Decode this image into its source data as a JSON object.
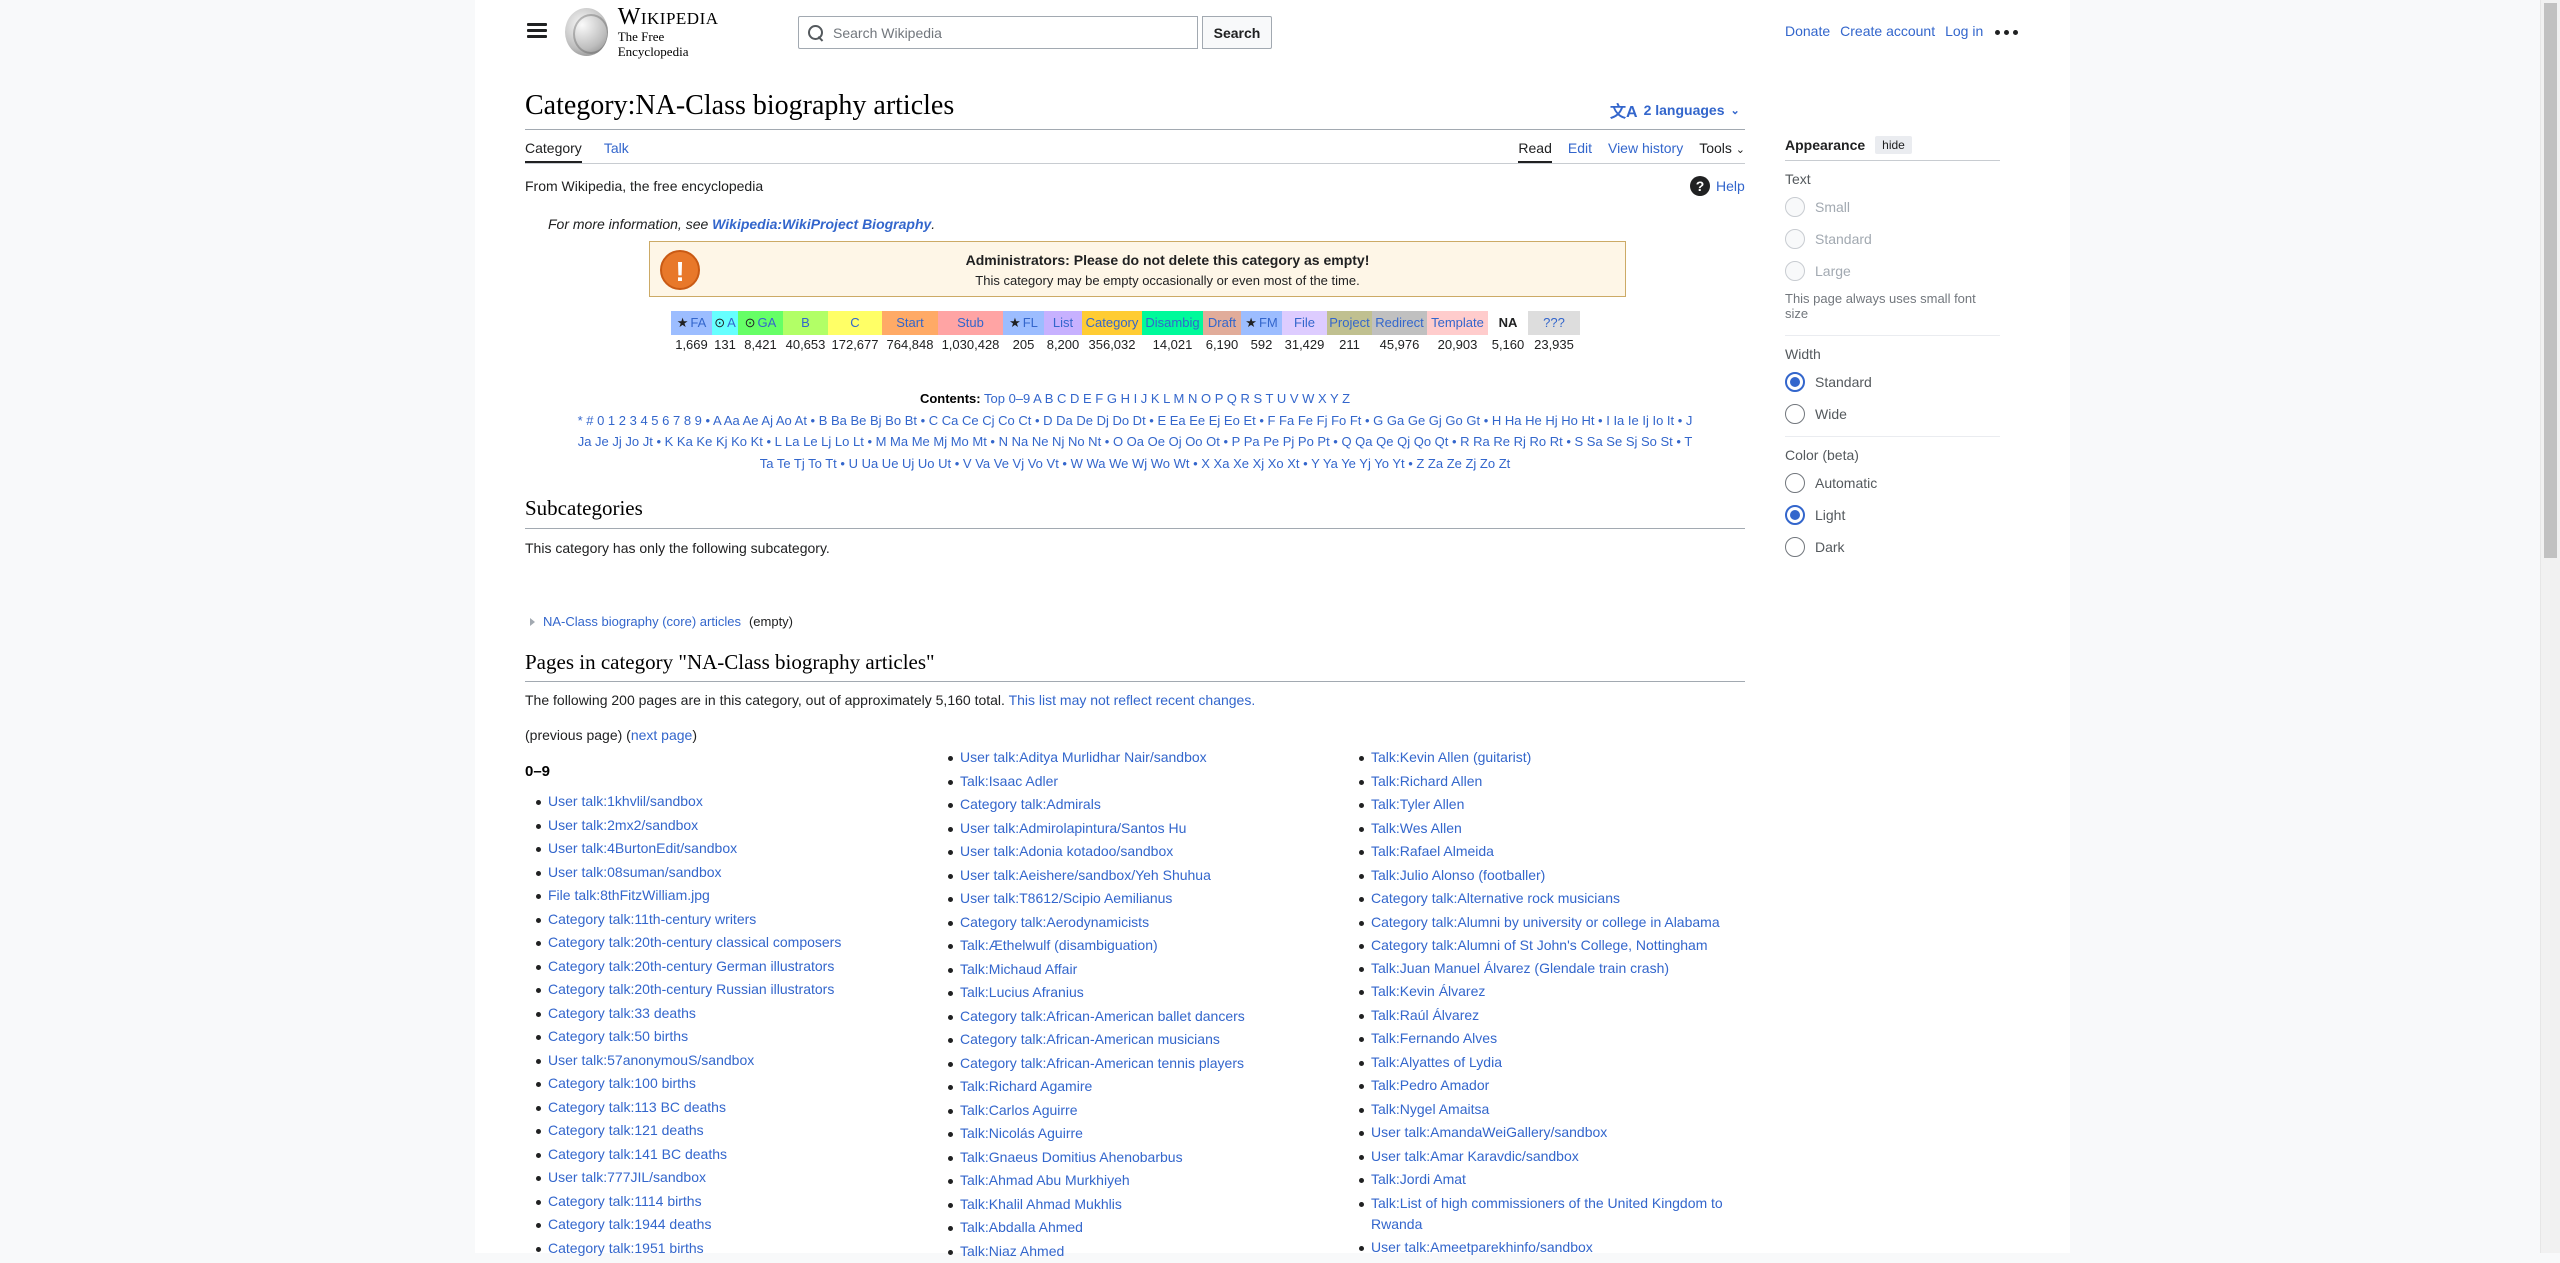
{
  "header": {
    "wordmark_title": "Wikipedia",
    "wordmark_tagline": "The Free Encyclopedia",
    "search_placeholder": "Search Wikipedia",
    "search_button": "Search",
    "user_links": [
      "Donate",
      "Create account",
      "Log in"
    ]
  },
  "page": {
    "title": "Category:NA-Class biography articles",
    "languages": "2 languages",
    "tabs_left": [
      "Category",
      "Talk"
    ],
    "tabs_right": [
      "Read",
      "Edit",
      "View history",
      "Tools"
    ],
    "tagline": "From Wikipedia, the free encyclopedia",
    "help": "Help",
    "moreinfo_prefix": "For more information, see ",
    "moreinfo_link": "Wikipedia:WikiProject Biography",
    "moreinfo_suffix": "."
  },
  "admin_box": {
    "heading": "Administrators: Please do not delete this category as empty!",
    "text": "This category may be empty occasionally or even most of the time."
  },
  "class_table": [
    {
      "label": "FA",
      "count": "1,669",
      "color": "#9cbdff",
      "star": true,
      "w": 41
    },
    {
      "label": "A",
      "count": "131",
      "color": "#66ffff",
      "circ": true,
      "w": 26
    },
    {
      "label": "GA",
      "count": "8,421",
      "color": "#66ff66",
      "circ": true,
      "w": 45
    },
    {
      "label": "B",
      "count": "40,653",
      "color": "#b2ff66",
      "w": 45
    },
    {
      "label": "C",
      "count": "172,677",
      "color": "#ffff66",
      "w": 54
    },
    {
      "label": "Start",
      "count": "764,848",
      "color": "#ffaa66",
      "w": 56
    },
    {
      "label": "Stub",
      "count": "1,030,428",
      "color": "#ffa4a4",
      "w": 65
    },
    {
      "label": "FL",
      "count": "205",
      "color": "#9cbdff",
      "star": true,
      "w": 41
    },
    {
      "label": "List",
      "count": "8,200",
      "color": "#c7b1ff",
      "w": 38
    },
    {
      "label": "Category",
      "count": "356,032",
      "color": "#ffcc33",
      "w": 60
    },
    {
      "label": "Disambig",
      "count": "14,021",
      "color": "#00fa9a",
      "w": 61
    },
    {
      "label": "Draft",
      "count": "6,190",
      "color": "#e1ac9a",
      "w": 38
    },
    {
      "label": "FM",
      "count": "592",
      "color": "#9cbdff",
      "star": true,
      "w": 41
    },
    {
      "label": "File",
      "count": "31,429",
      "color": "#ddccff",
      "w": 45
    },
    {
      "label": "Project",
      "count": "211",
      "color": "#c0c090",
      "w": 45
    },
    {
      "label": "Redirect",
      "count": "45,976",
      "color": "#c0c0c0",
      "w": 55
    },
    {
      "label": "Template",
      "count": "20,903",
      "color": "#ffcccc",
      "w": 61
    },
    {
      "label": "NA",
      "count": "5,160",
      "color": "#f5f5f5",
      "w": 40
    },
    {
      "label": "???",
      "count": "23,935",
      "color": "#dddddd",
      "w": 52
    }
  ],
  "contents": {
    "label": "Contents:",
    "line1": "Top 0–9 A B C D E F G H I J K L M N O P Q R S T U V W X Y Z",
    "line2": "* # 0 1 2 3 4 5 6 7 8 9 • A Aa Ae Aj Ao At • B Ba Be Bj Bo Bt • C Ca Ce Cj Co Ct • D Da De Dj Do Dt • E Ea Ee Ej Eo Et • F Fa Fe Fj Fo Ft • G Ga Ge Gj Go Gt • H Ha He Hj Ho Ht • I Ia Ie Ij Io It • J",
    "line3": "Ja Je Jj Jo Jt • K Ka Ke Kj Ko Kt • L La Le Lj Lo Lt • M Ma Me Mj Mo Mt • N Na Ne Nj No Nt • O Oa Oe Oj Oo Ot • P Pa Pe Pj Po Pt • Q Qa Qe Qj Qo Qt • R Ra Re Rj Ro Rt • S Sa Se Sj So St • T",
    "line4": "Ta Te Tj To Tt • U Ua Ue Uj Uo Ut • V Va Ve Vj Vo Vt • W Wa We Wj Wo Wt • X Xa Xe Xj Xo Xt • Y Ya Ye Yj Yo Yt • Z Za Ze Zj Zo Zt"
  },
  "subcategories": {
    "heading": "Subcategories",
    "text": "This category has only the following subcategory.",
    "item": "NA-Class biography (core) articles",
    "item_note": "(empty)"
  },
  "pages": {
    "heading": "Pages in category \"NA-Class biography articles\"",
    "info": "The following 200 pages are in this category, out of approximately 5,160 total. ",
    "info_link": "This list may not reflect recent changes.",
    "prev": "(previous page) (",
    "next": "next page",
    "close": ")",
    "section": "0–9",
    "col1": [
      "User talk:1khvlil/sandbox",
      "User talk:2mx2/sandbox",
      "User talk:4BurtonEdit/sandbox",
      "User talk:08suman/sandbox",
      "File talk:8thFitzWilliam.jpg",
      "Category talk:11th-century writers",
      "Category talk:20th-century classical composers",
      "Category talk:20th-century German illustrators",
      "Category talk:20th-century Russian illustrators",
      "Category talk:33 deaths",
      "Category talk:50 births",
      "User talk:57anonymouS/sandbox",
      "Category talk:100 births",
      "Category talk:113 BC deaths",
      "Category talk:121 deaths",
      "Category talk:141 BC deaths",
      "User talk:777JIL/sandbox",
      "Category talk:1114 births",
      "Category talk:1944 deaths",
      "Category talk:1951 births"
    ],
    "col2": [
      "User talk:Aditya Murlidhar Nair/sandbox",
      "Talk:Isaac Adler",
      "Category talk:Admirals",
      "User talk:Admirolapintura/Santos Hu",
      "User talk:Adonia kotadoo/sandbox",
      "User talk:Aeishere/sandbox/Yeh Shuhua",
      "User talk:T8612/Scipio Aemilianus",
      "Category talk:Aerodynamicists",
      "Talk:Æthelwulf (disambiguation)",
      "Talk:Michaud Affair",
      "Talk:Lucius Afranius",
      "Category talk:African-American ballet dancers",
      "Category talk:African-American musicians",
      "Category talk:African-American tennis players",
      "Talk:Richard Agamire",
      "Talk:Carlos Aguirre",
      "Talk:Nicolás Aguirre",
      "Talk:Gnaeus Domitius Ahenobarbus",
      "Talk:Ahmad Abu Murkhiyeh",
      "Talk:Khalil Ahmad Mukhlis",
      "Talk:Abdalla Ahmed",
      "Talk:Niaz Ahmed"
    ],
    "col3": [
      "Talk:Kevin Allen (guitarist)",
      "Talk:Richard Allen",
      "Talk:Tyler Allen",
      "Talk:Wes Allen",
      "Talk:Rafael Almeida",
      "Talk:Julio Alonso (footballer)",
      "Category talk:Alternative rock musicians",
      "Category talk:Alumni by university or college in Alabama",
      "Category talk:Alumni of St John's College, Nottingham",
      "Talk:Juan Manuel Álvarez (Glendale train crash)",
      "Talk:Kevin Álvarez",
      "Talk:Raúl Álvarez",
      "Talk:Fernando Alves",
      "Talk:Alyattes of Lydia",
      "Talk:Pedro Amador",
      "Talk:Nygel Amaitsa",
      "User talk:AmandaWeiGallery/sandbox",
      "User talk:Amar Karavdic/sandbox",
      "Talk:Jordi Amat",
      "Talk:List of high commissioners of the United Kingdom to Rwanda",
      "User talk:Ameetparekhinfo/sandbox"
    ]
  },
  "appearance": {
    "title": "Appearance",
    "hide": "hide",
    "text_label": "Text",
    "text_options": [
      "Small",
      "Standard",
      "Large"
    ],
    "text_note": "This page always uses small font size",
    "width_label": "Width",
    "width_options": [
      "Standard",
      "Wide"
    ],
    "width_selected": "Standard",
    "color_label": "Color (beta)",
    "color_options": [
      "Automatic",
      "Light",
      "Dark"
    ],
    "color_selected": "Light"
  }
}
